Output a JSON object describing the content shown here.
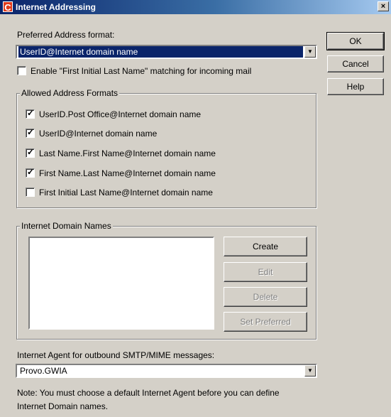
{
  "window": {
    "title": "Internet Addressing",
    "app_icon_letter": "C",
    "close_glyph": "×"
  },
  "preferred": {
    "label": "Preferred Address format:",
    "value": "UserID@Internet domain name",
    "enable_label": "Enable \"First Initial Last Name\" matching for incoming mail",
    "enable_checked": false
  },
  "allowed": {
    "title": "Allowed Address Formats",
    "items": [
      {
        "label": "UserID.Post Office@Internet domain name",
        "checked": true
      },
      {
        "label": "UserID@Internet domain name",
        "checked": true
      },
      {
        "label": "Last Name.First Name@Internet domain name",
        "checked": true
      },
      {
        "label": "First Name.Last Name@Internet domain name",
        "checked": true
      },
      {
        "label": "First Initial Last Name@Internet domain name",
        "checked": false
      }
    ]
  },
  "domains": {
    "title": "Internet Domain Names",
    "buttons": {
      "create": "Create",
      "edit": "Edit",
      "delete": "Delete",
      "set_preferred": "Set Preferred"
    }
  },
  "agent": {
    "label": "Internet Agent for outbound SMTP/MIME messages:",
    "value": "Provo.GWIA"
  },
  "note": {
    "line1": "Note:  You must choose a default Internet Agent before you can define",
    "line2": "Internet Domain names."
  },
  "side_buttons": {
    "ok": "OK",
    "cancel": "Cancel",
    "help": "Help"
  },
  "icons": {
    "dropdown": "▼",
    "check": "✓"
  }
}
